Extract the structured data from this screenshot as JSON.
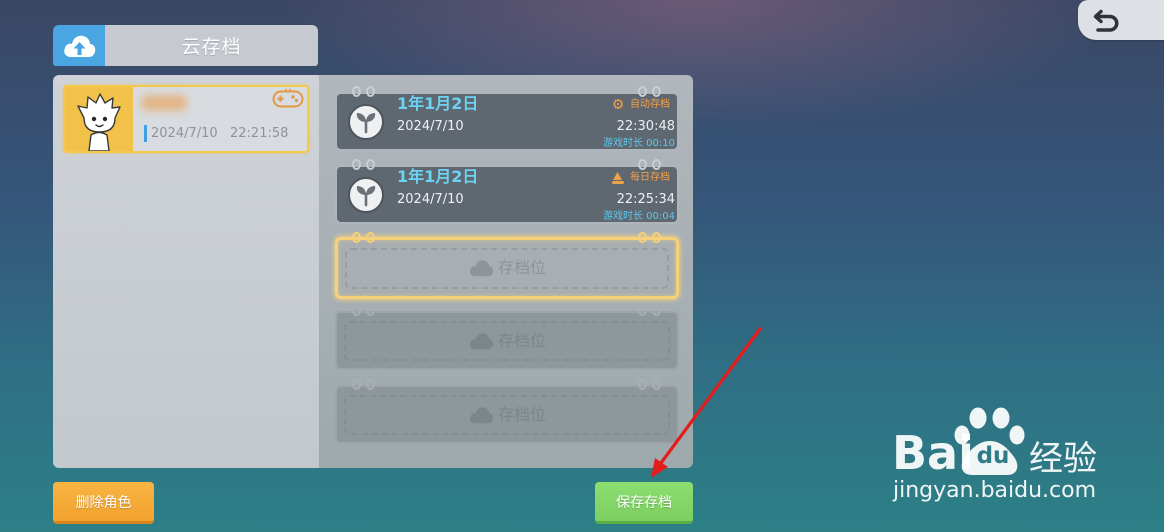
{
  "header": {
    "title": "云存档",
    "icon": "cloud-upload-icon"
  },
  "top_right": {
    "icon": "back-icon"
  },
  "character": {
    "date": "2024/7/10",
    "time": "22:21:58",
    "icon": "gamepad-icon"
  },
  "slots": [
    {
      "title": "1年1月2日",
      "date": "2024/7/10",
      "tag": "自动存档",
      "tag_icon": "gear-icon",
      "time": "22:30:48",
      "playtime": "游戏时长 00:10"
    },
    {
      "title": "1年1月2日",
      "date": "2024/7/10",
      "tag": "每日存档",
      "tag_icon": "daily-save-icon",
      "time": "22:25:34",
      "playtime": "游戏时长 00:04"
    },
    {
      "empty_label": "存档位",
      "selected": true
    },
    {
      "empty_label": "存档位",
      "selected": false
    },
    {
      "empty_label": "存档位",
      "selected": false
    }
  ],
  "buttons": {
    "delete": "删除角色",
    "save": "保存存档"
  },
  "watermark": {
    "brand_left": "Bai",
    "brand_paw": "du",
    "brand_right": "经验",
    "url": "jingyan.baidu.com"
  },
  "colors": {
    "title_cyan": "#6cd3f4",
    "tag_orange": "#f0a14c",
    "highlight_yellow": "#f6d17a",
    "delete_button": "#f5a935",
    "save_button": "#84d668",
    "annotation_arrow": "#e51c1c"
  }
}
